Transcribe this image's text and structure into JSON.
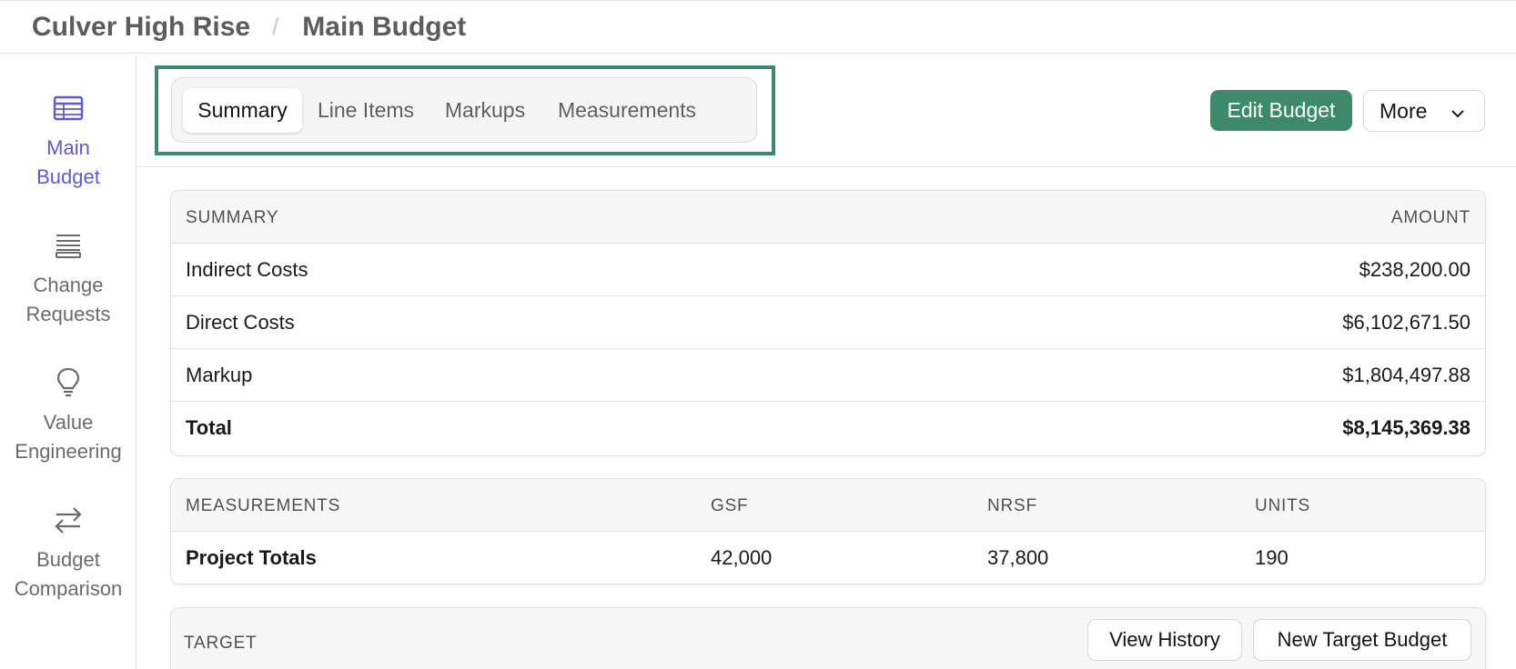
{
  "breadcrumb": {
    "project": "Culver High Rise",
    "separator": "/",
    "page": "Main Budget"
  },
  "sidebar": {
    "items": [
      {
        "label_line1": "Main",
        "label_line2": "Budget",
        "icon": "table-icon",
        "active": true
      },
      {
        "label_line1": "Change",
        "label_line2": "Requests",
        "icon": "stacked-lines-icon",
        "active": false
      },
      {
        "label_line1": "Value",
        "label_line2": "Engineering",
        "icon": "lightbulb-icon",
        "active": false
      },
      {
        "label_line1": "Budget",
        "label_line2": "Comparison",
        "icon": "arrows-exchange-icon",
        "active": false
      }
    ]
  },
  "tabs": [
    {
      "label": "Summary",
      "active": true
    },
    {
      "label": "Line Items",
      "active": false
    },
    {
      "label": "Markups",
      "active": false
    },
    {
      "label": "Measurements",
      "active": false
    }
  ],
  "actions": {
    "edit_budget": "Edit Budget",
    "more": "More"
  },
  "summary": {
    "header_left": "SUMMARY",
    "header_right": "AMOUNT",
    "rows": [
      {
        "label": "Indirect Costs",
        "amount": "$238,200.00"
      },
      {
        "label": "Direct Costs",
        "amount": "$6,102,671.50"
      },
      {
        "label": "Markup",
        "amount": "$1,804,497.88"
      },
      {
        "label": "Total",
        "amount": "$8,145,369.38"
      }
    ]
  },
  "measurements": {
    "headers": [
      "MEASUREMENTS",
      "GSF",
      "NRSF",
      "UNITS"
    ],
    "rows": [
      {
        "label": "Project Totals",
        "gsf": "42,000",
        "nrsf": "37,800",
        "units": "190"
      }
    ]
  },
  "target": {
    "header": "TARGET",
    "view_history": "View History",
    "new_target_budget": "New Target Budget"
  },
  "colors": {
    "accent_green": "#3d8a6b",
    "active_nav": "#5b5bd6",
    "muted_text": "#6b6b6b"
  }
}
